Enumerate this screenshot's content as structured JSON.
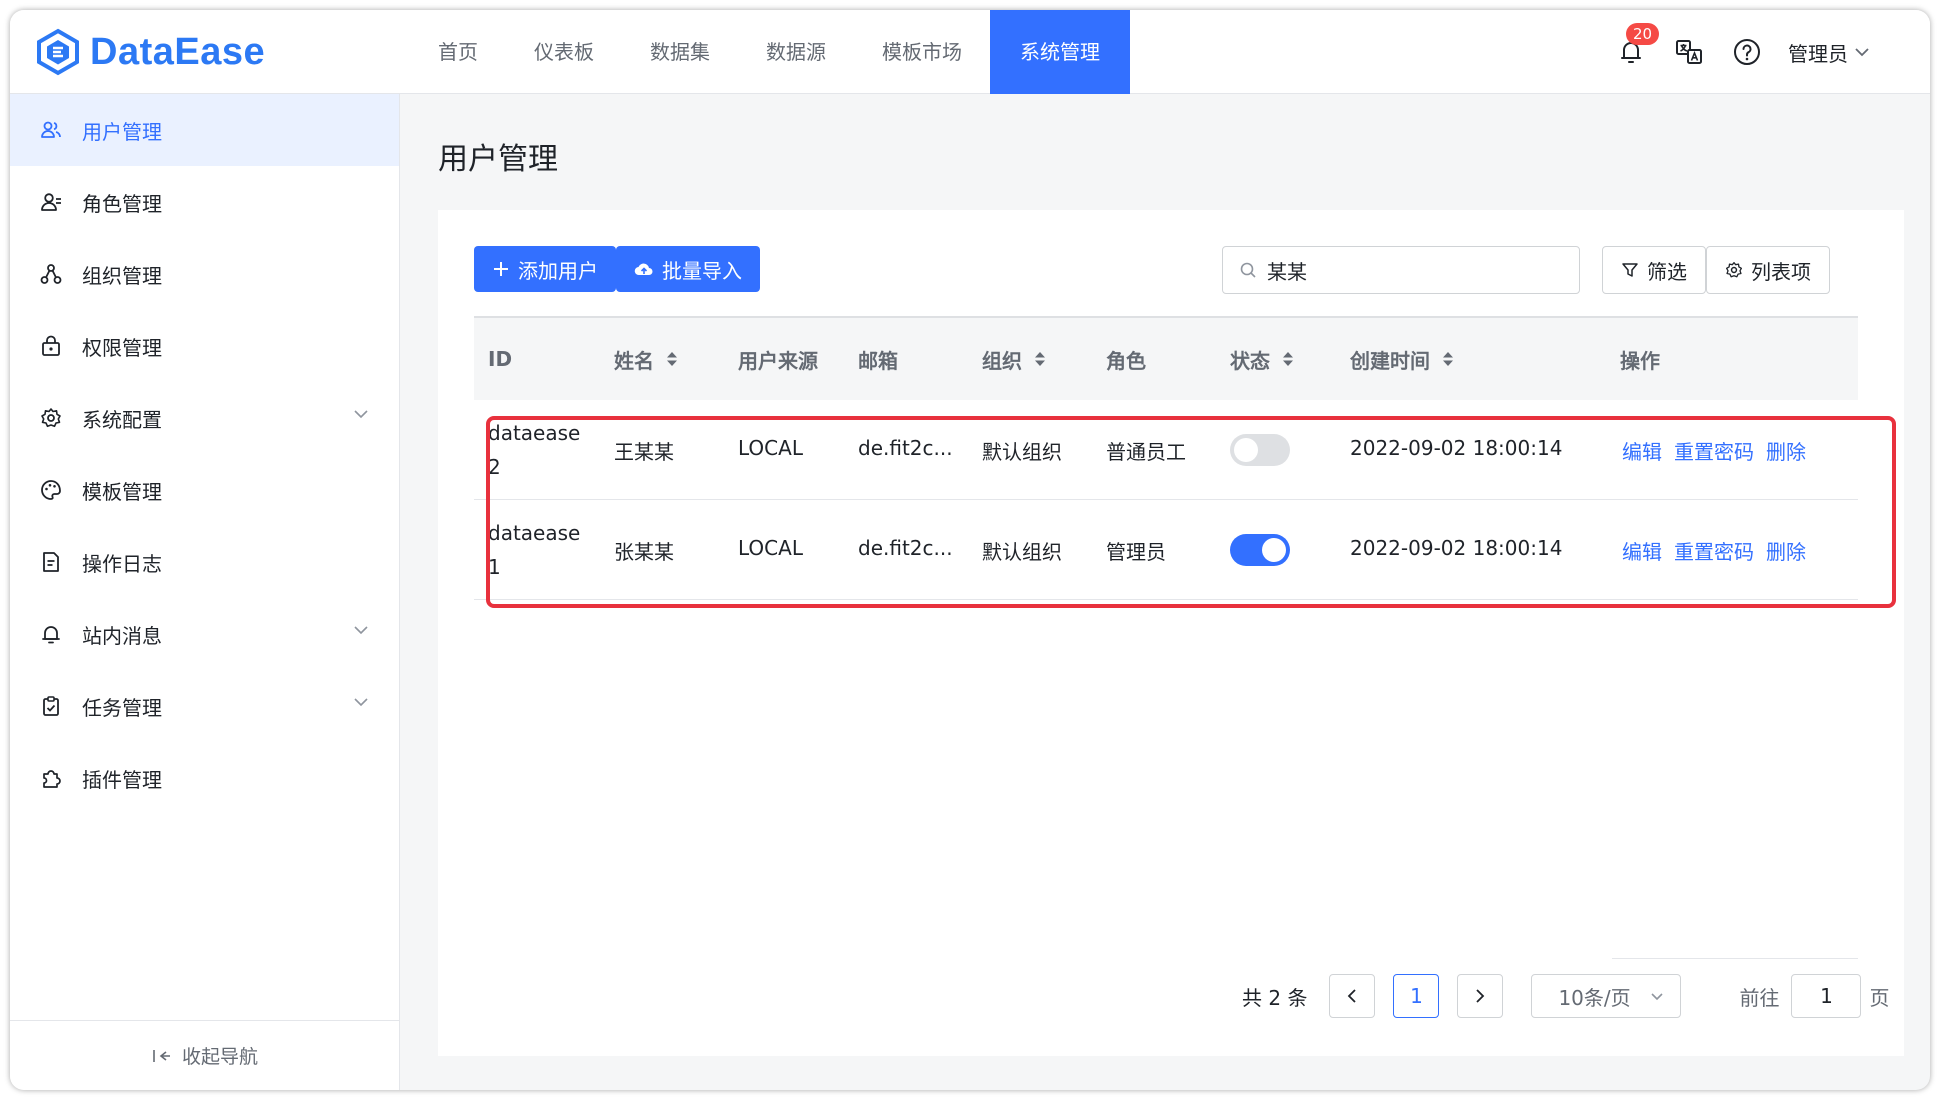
{
  "app": {
    "logo_text": "DataEase"
  },
  "nav": {
    "items": [
      {
        "label": "首页"
      },
      {
        "label": "仪表板"
      },
      {
        "label": "数据集"
      },
      {
        "label": "数据源"
      },
      {
        "label": "模板市场"
      },
      {
        "label": "系统管理"
      }
    ],
    "active_index": 5
  },
  "header": {
    "notification_count": "20",
    "user_label": "管理员"
  },
  "sidebar": {
    "items": [
      {
        "label": "用户管理",
        "icon": "users-icon",
        "active": true
      },
      {
        "label": "角色管理",
        "icon": "role-icon"
      },
      {
        "label": "组织管理",
        "icon": "org-icon"
      },
      {
        "label": "权限管理",
        "icon": "lock-icon"
      },
      {
        "label": "系统配置",
        "icon": "gear-icon",
        "expandable": true
      },
      {
        "label": "模板管理",
        "icon": "palette-icon"
      },
      {
        "label": "操作日志",
        "icon": "log-icon"
      },
      {
        "label": "站内消息",
        "icon": "bell-icon",
        "expandable": true
      },
      {
        "label": "任务管理",
        "icon": "clipboard-icon",
        "expandable": true
      },
      {
        "label": "插件管理",
        "icon": "plugin-icon"
      }
    ],
    "collapse_label": "收起导航"
  },
  "page": {
    "title": "用户管理"
  },
  "toolbar": {
    "add_user_label": "添加用户",
    "batch_import_label": "批量导入",
    "search_value": "某某",
    "filter_label": "筛选",
    "columns_label": "列表项"
  },
  "table": {
    "columns": [
      {
        "label": "ID",
        "sortable": false
      },
      {
        "label": "姓名",
        "sortable": true
      },
      {
        "label": "用户来源",
        "sortable": false
      },
      {
        "label": "邮箱",
        "sortable": false
      },
      {
        "label": "组织",
        "sortable": true
      },
      {
        "label": "角色",
        "sortable": false
      },
      {
        "label": "状态",
        "sortable": true
      },
      {
        "label": "创建时间",
        "sortable": true
      },
      {
        "label": "操作",
        "sortable": false
      }
    ],
    "rows": [
      {
        "id_line1": "dataease",
        "id_line2": "2",
        "name": "王某某",
        "source": "LOCAL",
        "email": "de.fit2c...",
        "org": "默认组织",
        "role": "普通员工",
        "enabled": false,
        "created": "2022-09-02 18:00:14"
      },
      {
        "id_line1": "dataease",
        "id_line2": "1",
        "name": "张某某",
        "source": "LOCAL",
        "email": "de.fit2c...",
        "org": "默认组织",
        "role": "管理员",
        "enabled": true,
        "created": "2022-09-02 18:00:14"
      }
    ],
    "actions": {
      "edit": "编辑",
      "reset_password": "重置密码",
      "delete": "删除"
    }
  },
  "pagination": {
    "total_label": "共 2 条",
    "current_page": "1",
    "page_size_label": "10条/页",
    "goto_prefix": "前往",
    "goto_value": "1",
    "goto_suffix": "页"
  },
  "colors": {
    "accent": "#3370ff",
    "highlight": "#e8313d",
    "badge": "#f54a45"
  }
}
